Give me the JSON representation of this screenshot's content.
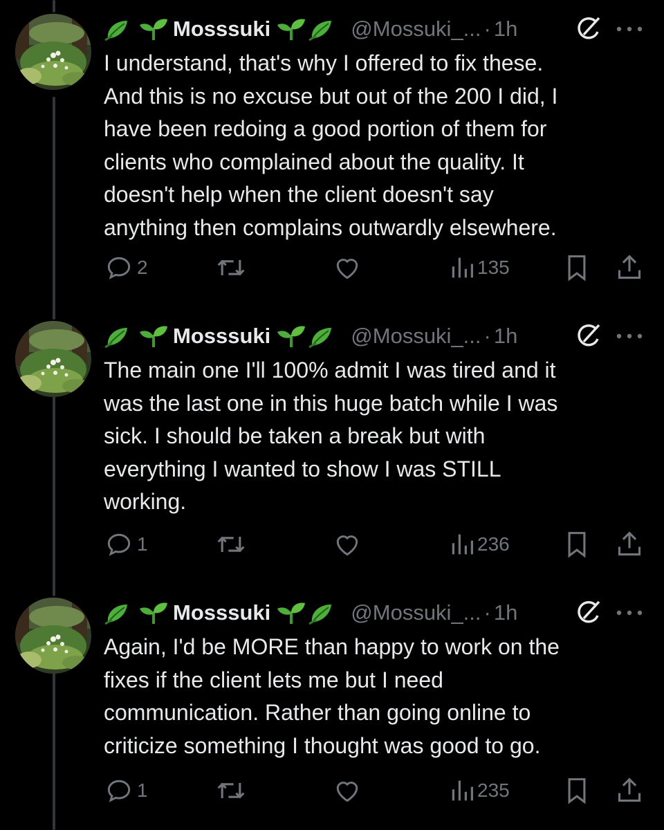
{
  "tweets": [
    {
      "name": "Mosssuki",
      "handle": "@Mossuki_...",
      "separator": "·",
      "time": "1h",
      "text": "I understand, that's why I offered to fix these.\nAnd this is no excuse but out of the 200 I did, I\nhave been redoing a good portion of them for\nclients who complained about the quality. It\ndoesn't help when the client doesn't say\nanything then complains outwardly elsewhere.",
      "replies": "2",
      "views": "135"
    },
    {
      "name": "Mosssuki",
      "handle": "@Mossuki_...",
      "separator": "·",
      "time": "1h",
      "text": "The main one I'll 100% admit I was tired and it\nwas the last one in this huge batch while I was\nsick. I should be taken a break but with\neverything I wanted to show I was STILL\nworking.",
      "replies": "1",
      "views": "236"
    },
    {
      "name": "Mosssuki",
      "handle": "@Mossuki_...",
      "separator": "·",
      "time": "1h",
      "text": "Again, I'd be MORE than happy to work on the\nfixes if the client lets me but I need\ncommunication. Rather than going online to\ncriticize something I thought was good to go.",
      "replies": "1",
      "views": "235"
    }
  ],
  "icons": {
    "name_decoration": [
      "leaf-emoji-icon",
      "seedling-emoji-icon"
    ],
    "grok": "grok-icon",
    "more": "more-icon",
    "reply": "reply-icon",
    "retweet": "retweet-icon",
    "like": "like-icon",
    "views": "views-icon",
    "bookmark": "bookmark-icon",
    "share": "share-icon"
  },
  "colors": {
    "background": "#000000",
    "text": "#e7e9ea",
    "muted": "#71767b",
    "thread_line": "#333639"
  }
}
